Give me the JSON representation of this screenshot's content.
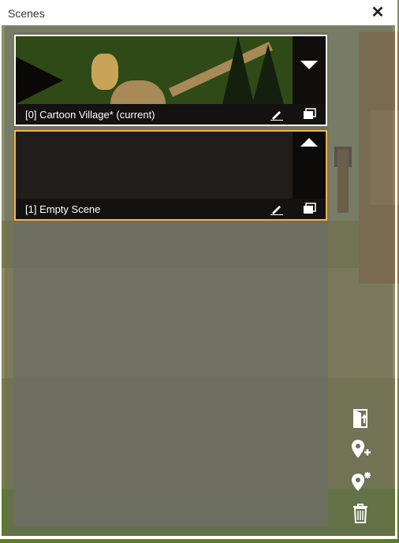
{
  "window": {
    "title": "Scenes",
    "close_icon": "close-icon"
  },
  "scenes": [
    {
      "label": "[0] Cartoon Village* (current)",
      "toggle_icon": "chevron-down-icon",
      "selected": false,
      "border_color": "#ffffff"
    },
    {
      "label": "[1] Empty Scene",
      "toggle_icon": "chevron-up-icon",
      "selected": true,
      "border_color": "#f3b545"
    }
  ],
  "scene_actions": {
    "edit_icon": "pencil-icon",
    "duplicate_icon": "duplicate-icon"
  },
  "toolbar": [
    {
      "icon": "door-exit-icon"
    },
    {
      "icon": "add-location-icon"
    },
    {
      "icon": "location-settings-icon"
    },
    {
      "icon": "trash-icon"
    }
  ],
  "colors": {
    "accent": "#f3b545",
    "window_border": "#ffffff"
  }
}
